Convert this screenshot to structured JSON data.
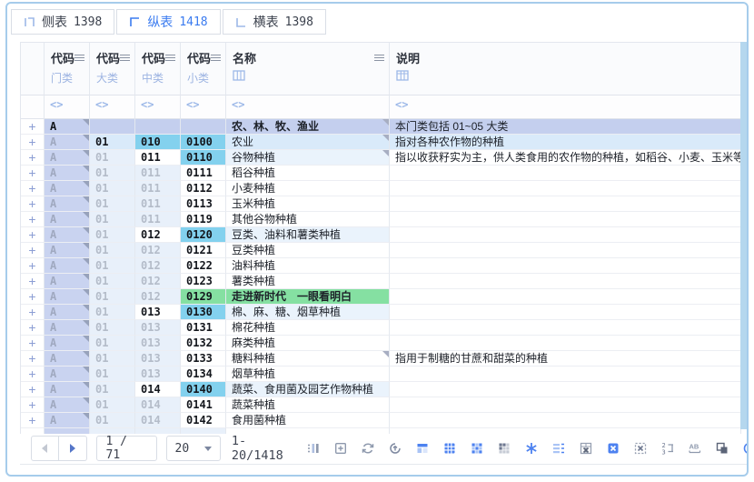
{
  "tabs": [
    {
      "label": "侧表",
      "count": "1398",
      "active": false
    },
    {
      "label": "纵表",
      "count": "1418",
      "active": true
    },
    {
      "label": "横表",
      "count": "1398",
      "active": false
    }
  ],
  "table": {
    "expand_glyph": "+",
    "type_glyph": "<>",
    "columns": [
      {
        "title": "代码",
        "sub": "门类"
      },
      {
        "title": "代码",
        "sub": "大类"
      },
      {
        "title": "代码",
        "sub": "中类"
      },
      {
        "title": "代码",
        "sub": "小类"
      },
      {
        "title": "名称",
        "sub_icon": "table-grid-icon"
      },
      {
        "title": "说明",
        "sub_icon": "table-grid-icon"
      }
    ],
    "rows": [
      {
        "m": "A",
        "ms": "first",
        "da": "",
        "das": "b1",
        "zh": "",
        "zhs": "b1",
        "xi": "",
        "xis": "b1",
        "name": "农、林、牧、渔业",
        "ns": "l1",
        "nm": true,
        "desc": "本门类包括 01~05 大类",
        "ds": "l1"
      },
      {
        "m": "A",
        "ms": "ctx",
        "da": "01",
        "das": "own2",
        "zh": "010",
        "zhs": "auto",
        "xi": "0100",
        "xis": "auto",
        "name": "农业",
        "ns": "l2",
        "nm": true,
        "desc": "指对各种农作物的种植",
        "ds": "l2"
      },
      {
        "m": "A",
        "ms": "ctx",
        "da": "01",
        "das": "ctx",
        "zh": "011",
        "zhs": "own",
        "xi": "0110",
        "xis": "auto",
        "name": "谷物种植",
        "ns": "l3",
        "nm": true,
        "desc": "指以收获籽实为主，供人类食用的农作物的种植，如稻谷、小麦、玉米等农",
        "ds": "w"
      },
      {
        "m": "A",
        "ms": "ctx",
        "da": "01",
        "das": "ctx",
        "zh": "011",
        "zhs": "ctx",
        "xi": "0111",
        "xis": "own",
        "name": "稻谷种植",
        "ns": "leaf",
        "nm": false,
        "desc": "",
        "ds": "w"
      },
      {
        "m": "A",
        "ms": "ctx",
        "da": "01",
        "das": "ctx",
        "zh": "011",
        "zhs": "ctx",
        "xi": "0112",
        "xis": "own",
        "name": "小麦种植",
        "ns": "leaf",
        "nm": false,
        "desc": "",
        "ds": "w"
      },
      {
        "m": "A",
        "ms": "ctx",
        "da": "01",
        "das": "ctx",
        "zh": "011",
        "zhs": "ctx",
        "xi": "0113",
        "xis": "own",
        "name": "玉米种植",
        "ns": "leaf",
        "nm": false,
        "desc": "",
        "ds": "w"
      },
      {
        "m": "A",
        "ms": "ctx",
        "da": "01",
        "das": "ctx",
        "zh": "011",
        "zhs": "ctx",
        "xi": "0119",
        "xis": "own",
        "name": "其他谷物种植",
        "ns": "leaf",
        "nm": false,
        "desc": "",
        "ds": "w"
      },
      {
        "m": "A",
        "ms": "ctx",
        "da": "01",
        "das": "ctx",
        "zh": "012",
        "zhs": "own",
        "xi": "0120",
        "xis": "auto",
        "name": "豆类、油料和薯类种植",
        "ns": "l3",
        "nm": false,
        "desc": "",
        "ds": "w"
      },
      {
        "m": "A",
        "ms": "ctx",
        "da": "01",
        "das": "ctx",
        "zh": "012",
        "zhs": "ctx",
        "xi": "0121",
        "xis": "own",
        "name": "豆类种植",
        "ns": "leaf",
        "nm": false,
        "desc": "",
        "ds": "w"
      },
      {
        "m": "A",
        "ms": "ctx",
        "da": "01",
        "das": "ctx",
        "zh": "012",
        "zhs": "ctx",
        "xi": "0122",
        "xis": "own",
        "name": "油料种植",
        "ns": "leaf",
        "nm": false,
        "desc": "",
        "ds": "w"
      },
      {
        "m": "A",
        "ms": "ctx",
        "da": "01",
        "das": "ctx",
        "zh": "012",
        "zhs": "ctx",
        "xi": "0123",
        "xis": "own",
        "name": "薯类种植",
        "ns": "leaf",
        "nm": false,
        "desc": "",
        "ds": "w"
      },
      {
        "m": "A",
        "ms": "ctx",
        "da": "01",
        "das": "ctx",
        "zh": "012",
        "zhs": "ctx",
        "xi": "0129",
        "xis": "edit",
        "name": "走进新时代　一眼看明白",
        "ns": "edit",
        "nm": false,
        "desc": "",
        "ds": "w"
      },
      {
        "m": "A",
        "ms": "ctx",
        "da": "01",
        "das": "ctx",
        "zh": "013",
        "zhs": "own",
        "xi": "0130",
        "xis": "auto",
        "name": "棉、麻、糖、烟草种植",
        "ns": "l3",
        "nm": false,
        "desc": "",
        "ds": "w"
      },
      {
        "m": "A",
        "ms": "ctx",
        "da": "01",
        "das": "ctx",
        "zh": "013",
        "zhs": "ctx",
        "xi": "0131",
        "xis": "own",
        "name": "棉花种植",
        "ns": "leaf",
        "nm": false,
        "desc": "",
        "ds": "w"
      },
      {
        "m": "A",
        "ms": "ctx",
        "da": "01",
        "das": "ctx",
        "zh": "013",
        "zhs": "ctx",
        "xi": "0132",
        "xis": "own",
        "name": "麻类种植",
        "ns": "leaf",
        "nm": false,
        "desc": "",
        "ds": "w"
      },
      {
        "m": "A",
        "ms": "ctx",
        "da": "01",
        "das": "ctx",
        "zh": "013",
        "zhs": "ctx",
        "xi": "0133",
        "xis": "own",
        "name": "糖料种植",
        "ns": "leaf",
        "nm": true,
        "desc": "指用于制糖的甘蔗和甜菜的种植",
        "ds": "w"
      },
      {
        "m": "A",
        "ms": "ctx",
        "da": "01",
        "das": "ctx",
        "zh": "013",
        "zhs": "ctx",
        "xi": "0134",
        "xis": "own",
        "name": "烟草种植",
        "ns": "leaf",
        "nm": false,
        "desc": "",
        "ds": "w"
      },
      {
        "m": "A",
        "ms": "ctx",
        "da": "01",
        "das": "ctx",
        "zh": "014",
        "zhs": "own",
        "xi": "0140",
        "xis": "auto",
        "name": "蔬菜、食用菌及园艺作物种植",
        "ns": "l3",
        "nm": false,
        "desc": "",
        "ds": "w"
      },
      {
        "m": "A",
        "ms": "ctx",
        "da": "01",
        "das": "ctx",
        "zh": "014",
        "zhs": "ctx",
        "xi": "0141",
        "xis": "own",
        "name": "蔬菜种植",
        "ns": "leaf",
        "nm": false,
        "desc": "",
        "ds": "w"
      },
      {
        "m": "A",
        "ms": "ctx",
        "da": "01",
        "das": "ctx",
        "zh": "014",
        "zhs": "ctx",
        "xi": "0142",
        "xis": "own",
        "name": "食用菌种植",
        "ns": "leaf",
        "nm": false,
        "desc": "",
        "ds": "w"
      }
    ]
  },
  "footer": {
    "page_display": "1 / 71",
    "page_size": "20",
    "range": "1-20/1418",
    "icon_names": [
      "prev-page-button",
      "next-page-button",
      "page-size-select",
      "table-columns-icon",
      "insert-plus-icon",
      "refresh-icon",
      "sync-icon",
      "layout-header-icon",
      "table-cells-blue-icon",
      "grid-mixed-icon",
      "grid-gray-icon",
      "asterisk-icon",
      "row-list-icon",
      "excel-grid-icon",
      "excel-blue-icon",
      "pattern-x-icon",
      "sort-23-icon",
      "ab-rename-icon",
      "merge-squares-icon",
      "edge-partial-icon"
    ]
  },
  "colors": {
    "accent_blue": "#3a7bf0",
    "row_l1": "#c4cfee",
    "row_l2": "#d9eafa",
    "row_l3": "#eaf3fc",
    "auto_cyan": "#83d1ee",
    "edited_green": "#85e0a2",
    "scrollbar": "#b5d7ee",
    "outer_border": "#a6cceb"
  }
}
